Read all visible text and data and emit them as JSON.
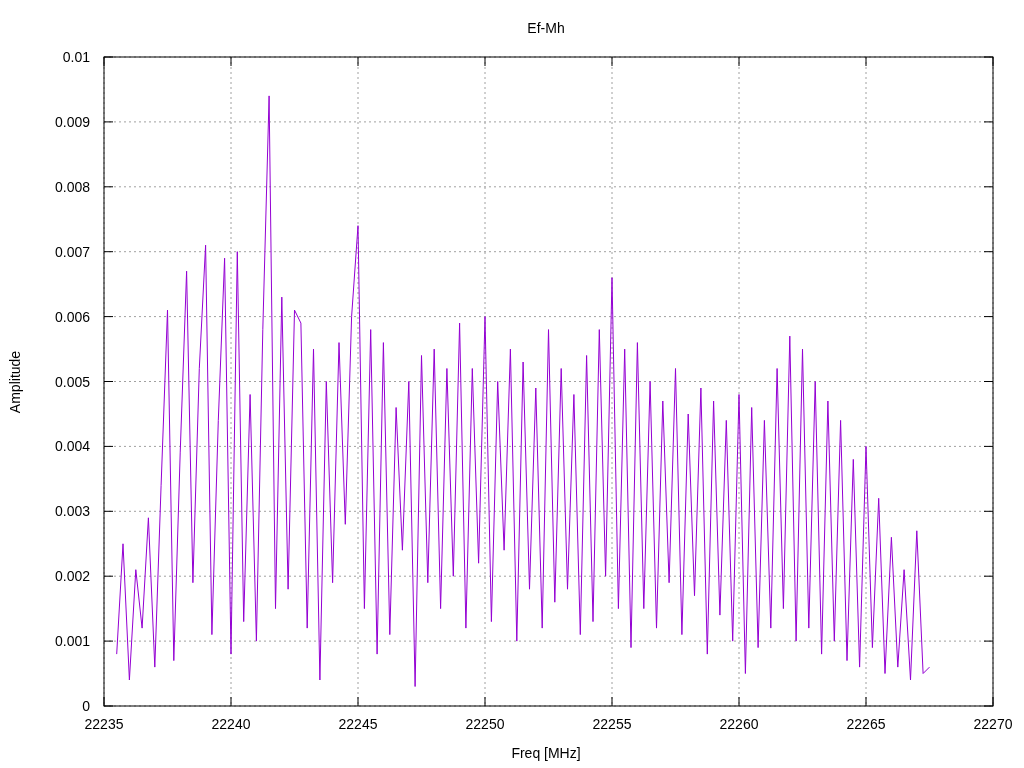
{
  "chart_data": {
    "type": "line",
    "grid": true,
    "title": "Ef-Mh",
    "xlabel": "Freq [MHz]",
    "ylabel": "Amplitude",
    "xlim": [
      22235,
      22270
    ],
    "ylim": [
      0,
      0.01
    ],
    "xticks": [
      22235,
      22240,
      22245,
      22250,
      22255,
      22260,
      22265,
      22270
    ],
    "yticks": [
      0,
      0.001,
      0.002,
      0.003,
      0.004,
      0.005,
      0.006,
      0.007,
      0.008,
      0.009,
      0.01
    ],
    "x": [
      22235.5,
      22235.75,
      22236,
      22236.25,
      22236.5,
      22236.75,
      22237,
      22237.25,
      22237.5,
      22237.75,
      22238,
      22238.25,
      22238.5,
      22238.75,
      22239,
      22239.25,
      22239.5,
      22239.75,
      22240,
      22240.25,
      22240.5,
      22240.75,
      22241,
      22241.25,
      22241.5,
      22241.75,
      22242,
      22242.25,
      22242.5,
      22242.75,
      22243,
      22243.25,
      22243.5,
      22243.75,
      22244,
      22244.25,
      22244.5,
      22244.75,
      22245,
      22245.25,
      22245.5,
      22245.75,
      22246,
      22246.25,
      22246.5,
      22246.75,
      22247,
      22247.25,
      22247.5,
      22247.75,
      22248,
      22248.25,
      22248.5,
      22248.75,
      22249,
      22249.25,
      22249.5,
      22249.75,
      22250,
      22250.25,
      22250.5,
      22250.75,
      22251,
      22251.25,
      22251.5,
      22251.75,
      22252,
      22252.25,
      22252.5,
      22252.75,
      22253,
      22253.25,
      22253.5,
      22253.75,
      22254,
      22254.25,
      22254.5,
      22254.75,
      22255,
      22255.25,
      22255.5,
      22255.75,
      22256,
      22256.25,
      22256.5,
      22256.75,
      22257,
      22257.25,
      22257.5,
      22257.75,
      22258,
      22258.25,
      22258.5,
      22258.75,
      22259,
      22259.25,
      22259.5,
      22259.75,
      22260,
      22260.25,
      22260.5,
      22260.75,
      22261,
      22261.25,
      22261.5,
      22261.75,
      22262,
      22262.25,
      22262.5,
      22262.75,
      22263,
      22263.25,
      22263.5,
      22263.75,
      22264,
      22264.25,
      22264.5,
      22264.75,
      22265,
      22265.25,
      22265.5,
      22265.75,
      22266,
      22266.25,
      22266.5,
      22266.75,
      22267,
      22267.25,
      22267.5
    ],
    "series": [
      {
        "color": "#9400d3",
        "values": [
          0.0008,
          0.0025,
          0.0004,
          0.0021,
          0.0012,
          0.0029,
          0.0006,
          0.0034,
          0.0061,
          0.0007,
          0.0039,
          0.0067,
          0.0019,
          0.0052,
          0.0071,
          0.0011,
          0.0044,
          0.0069,
          0.0008,
          0.007,
          0.0013,
          0.0048,
          0.001,
          0.0058,
          0.0094,
          0.0015,
          0.0063,
          0.0018,
          0.0061,
          0.0059,
          0.0012,
          0.0055,
          0.0004,
          0.005,
          0.0019,
          0.0056,
          0.0028,
          0.006,
          0.0074,
          0.0015,
          0.0058,
          0.0008,
          0.0056,
          0.0011,
          0.0046,
          0.0024,
          0.005,
          0.0003,
          0.0054,
          0.0019,
          0.0055,
          0.0015,
          0.0052,
          0.002,
          0.0059,
          0.0012,
          0.0052,
          0.0022,
          0.006,
          0.0013,
          0.005,
          0.0024,
          0.0055,
          0.001,
          0.0053,
          0.0018,
          0.0049,
          0.0012,
          0.0058,
          0.0016,
          0.0052,
          0.0018,
          0.0048,
          0.0011,
          0.0054,
          0.0013,
          0.0058,
          0.002,
          0.0066,
          0.0015,
          0.0055,
          0.0009,
          0.0056,
          0.0015,
          0.005,
          0.0012,
          0.0047,
          0.0019,
          0.0052,
          0.0011,
          0.0045,
          0.0017,
          0.0049,
          0.0008,
          0.0047,
          0.0014,
          0.0044,
          0.001,
          0.0048,
          0.0005,
          0.0046,
          0.0009,
          0.0044,
          0.0012,
          0.0052,
          0.0015,
          0.0057,
          0.001,
          0.0055,
          0.0012,
          0.005,
          0.0008,
          0.0047,
          0.001,
          0.0044,
          0.0007,
          0.0038,
          0.0006,
          0.004,
          0.0009,
          0.0032,
          0.0005,
          0.0026,
          0.0006,
          0.0021,
          0.0004,
          0.0027,
          0.0005,
          0.0006
        ]
      }
    ]
  }
}
